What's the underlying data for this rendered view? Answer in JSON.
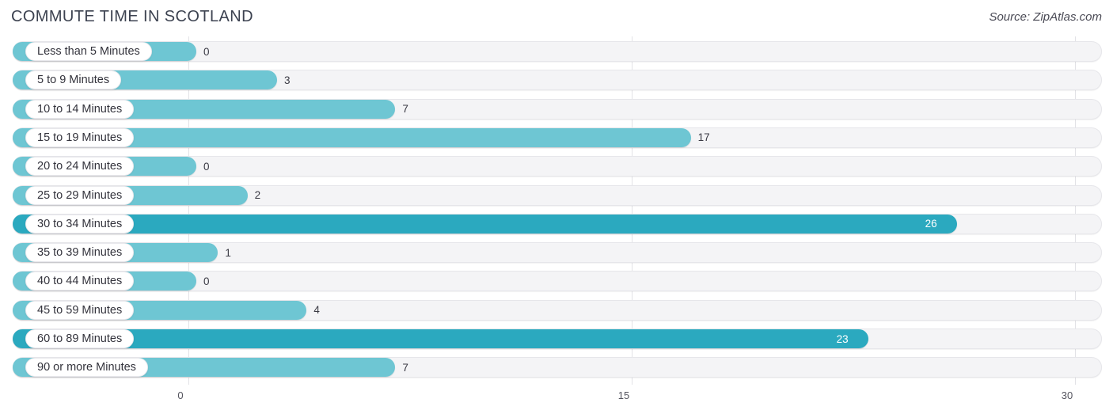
{
  "header": {
    "title": "COMMUTE TIME IN SCOTLAND",
    "source": "Source: ZipAtlas.com"
  },
  "colors": {
    "bar_light": "#6ec6d3",
    "bar_dark": "#2ba9bf",
    "track": "#f4f4f6",
    "gridline": "#e2e2e6",
    "text": "#3a3a44",
    "value_inside": "#ffffff"
  },
  "axis": {
    "ticks": [
      "0",
      "15",
      "30"
    ],
    "tick_values": [
      0,
      15,
      30
    ],
    "min": 0,
    "max": 30
  },
  "chart_data": {
    "type": "bar",
    "orientation": "horizontal",
    "title": "COMMUTE TIME IN SCOTLAND",
    "subtitle": "",
    "xlabel": "",
    "ylabel": "",
    "xlim": [
      0,
      30
    ],
    "grid": true,
    "legend": "none",
    "source": "Source: ZipAtlas.com",
    "categories": [
      "Less than 5 Minutes",
      "5 to 9 Minutes",
      "10 to 14 Minutes",
      "15 to 19 Minutes",
      "20 to 24 Minutes",
      "25 to 29 Minutes",
      "30 to 34 Minutes",
      "35 to 39 Minutes",
      "40 to 44 Minutes",
      "45 to 59 Minutes",
      "60 to 89 Minutes",
      "90 or more Minutes"
    ],
    "values": [
      0,
      3,
      7,
      17,
      0,
      2,
      26,
      1,
      0,
      4,
      23,
      7
    ],
    "value_labels": [
      "0",
      "3",
      "7",
      "17",
      "0",
      "2",
      "26",
      "1",
      "0",
      "4",
      "23",
      "7"
    ],
    "highlighted": [
      false,
      false,
      false,
      false,
      false,
      false,
      true,
      false,
      false,
      false,
      true,
      false
    ]
  }
}
